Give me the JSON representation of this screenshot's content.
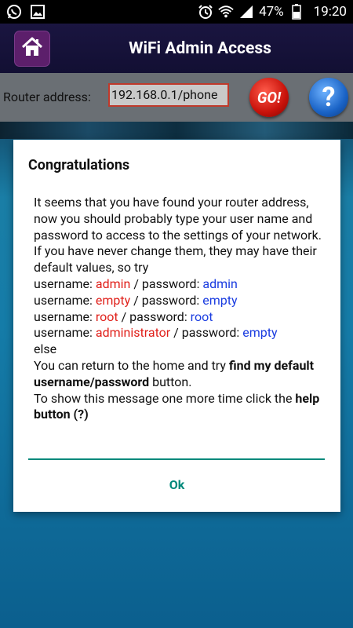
{
  "status_bar": {
    "battery": "47%",
    "time": "19:20",
    "left_icons": [
      "whatsapp-icon",
      "image-icon"
    ],
    "right_icons": [
      "alarm-icon",
      "wifi-icon",
      "signal-icon",
      "battery-icon"
    ]
  },
  "header": {
    "title": "WiFi Admin Access",
    "home_icon": "home-icon"
  },
  "router_bar": {
    "label": "Router address:",
    "address_value": "192.168.0.1/phone",
    "go_label": "GO!",
    "help_label": "?"
  },
  "dialog": {
    "title": "Congratulations",
    "intro": "It seems that you have found your router address, now you should probably type your user name and password to access to the settings of your network.",
    "if_never": "If you have never change them, they may have their default values, so try",
    "credentials": [
      {
        "user_label": "username: ",
        "user": "admin",
        "pass_label": " / password: ",
        "pass": "admin"
      },
      {
        "user_label": "username: ",
        "user": "empty",
        "pass_label": " / password: ",
        "pass": "empty"
      },
      {
        "user_label": "username: ",
        "user": "root",
        "pass_label": " / password: ",
        "pass": "root"
      },
      {
        "user_label": "username: ",
        "user": "administrator",
        "pass_label": " / password: ",
        "pass": "empty"
      }
    ],
    "else": "else",
    "return_prefix": "You can return to the home and try ",
    "return_bold": "find my default username/password",
    "return_suffix": " button.",
    "show_prefix": "To show this message one more time click the ",
    "show_bold": "help button (?)",
    "ok_label": "Ok"
  },
  "colors": {
    "accent": "#00897b",
    "username_color": "#e0201a",
    "password_color": "#1a3ce0"
  }
}
